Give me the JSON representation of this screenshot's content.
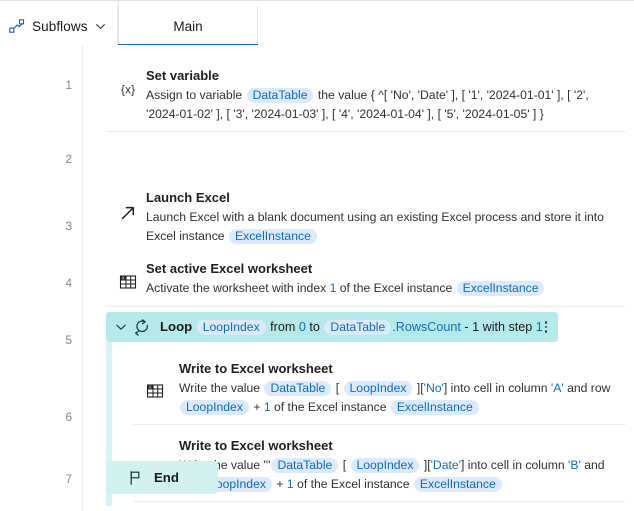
{
  "topbar": {
    "subflows_label": "Subflows",
    "tabs": [
      {
        "label": "Main",
        "active": true
      }
    ]
  },
  "canvas": {
    "line_numbers": [
      "1",
      "2",
      "3",
      "4",
      "5",
      "6",
      "7"
    ],
    "rows": [
      {
        "n": "1",
        "icon": "set-variable-icon",
        "title": "Set variable",
        "desc_plain": "Assign to variable DataTable the value { ^[ 'No', 'Date' ], [ '1', '2024-01-01' ], [ '2', '2024-01-02' ], [ '3', '2024-01-03' ], [ '4', '2024-01-04' ], [ '5', '2024-01-05' ] }",
        "desc_pre": "Assign to variable ",
        "var1": "DataTable",
        "desc_post": " the value { ^[ 'No', 'Date' ], [ '1', '2024-01-01' ], [ '2', '2024-01-02' ], [ '3', '2024-01-03' ], [ '4', '2024-01-04' ], [ '5', '2024-01-05' ] }"
      },
      {
        "n": "2",
        "icon": "launch-arrow-icon",
        "title": "Launch Excel",
        "desc_pre": "Launch Excel with a blank document using an existing Excel process and store it into Excel instance ",
        "var1": "ExcelInstance",
        "desc_post": ""
      },
      {
        "n": "3",
        "icon": "excel-sheet-icon",
        "title": "Set active Excel worksheet",
        "desc_pre": "Activate the worksheet with index ",
        "num1": "1",
        "desc_mid": " of the Excel instance ",
        "var1": "ExcelInstance",
        "desc_post": ""
      }
    ],
    "loop": {
      "n": "4",
      "icon": "loop-icon",
      "chevron": "chevron-down-icon",
      "keyword": "Loop",
      "index_var": "LoopIndex",
      "from_label": "from",
      "from_value": "0",
      "to_label": "to",
      "source_var": "DataTable",
      "source_prop": ".RowsCount",
      "minus_label": "- 1",
      "step_label": "with step",
      "step_value": "1",
      "menu": "more-options-icon"
    },
    "loop_body": [
      {
        "n": "5",
        "icon": "excel-sheet-icon",
        "title": "Write to Excel worksheet",
        "seg_1": "Write the value ",
        "var_1": "DataTable",
        "seg_2": "[",
        "var_2": "LoopIndex",
        "seg_3": "][",
        "key": "'No'",
        "seg_4": "] into cell in column ",
        "column": "'A'",
        "seg_5": " and row ",
        "var_3": "LoopIndex",
        "seg_6": "+",
        "num_1": "1",
        "seg_7": " of the Excel instance ",
        "var_4": "ExcelInstance"
      },
      {
        "n": "6",
        "icon": "excel-sheet-icon",
        "title": "Write to Excel worksheet",
        "seg_1": "Write the value '''",
        "var_1": "DataTable",
        "seg_2": "[",
        "var_2": "LoopIndex",
        "seg_3": "][",
        "key": "'Date'",
        "seg_4": "] into cell in column ",
        "column": "'B'",
        "seg_5": " and row ",
        "var_3": "LoopIndex",
        "seg_6": "+",
        "num_1": "1",
        "seg_7": " of the Excel instance ",
        "var_4": "ExcelInstance"
      }
    ],
    "end": {
      "n": "7",
      "icon": "flag-icon",
      "label": "End"
    }
  },
  "colors": {
    "accent_blue": "#0f6cbd",
    "pill_bg": "#dbeafd",
    "loop_header_bg": "#b5eaea",
    "loop_spine_bg": "#d8f3f3",
    "end_bg": "#d2f2f2"
  }
}
